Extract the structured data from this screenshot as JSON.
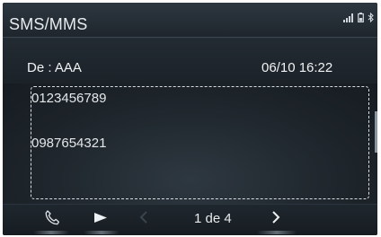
{
  "app": {
    "title": "SMS/MMS"
  },
  "status": {
    "signal_icon": "signal-bars-icon",
    "battery_icon": "battery-icon",
    "bluetooth_icon": "bluetooth-icon"
  },
  "message": {
    "from_label": "De :",
    "sender": "AAA",
    "datetime": "06/10 16:22",
    "lines": [
      "0123456789",
      "0987654321"
    ]
  },
  "controls": {
    "call_icon": "phone-icon",
    "play_icon": "play-icon",
    "prev_icon": "chevron-left-icon",
    "next_icon": "chevron-right-icon",
    "page_indicator": "1 de 4"
  },
  "colors": {
    "background": "#1a2026",
    "text": "#e8ecef",
    "selection_border": "#d8dde1"
  }
}
